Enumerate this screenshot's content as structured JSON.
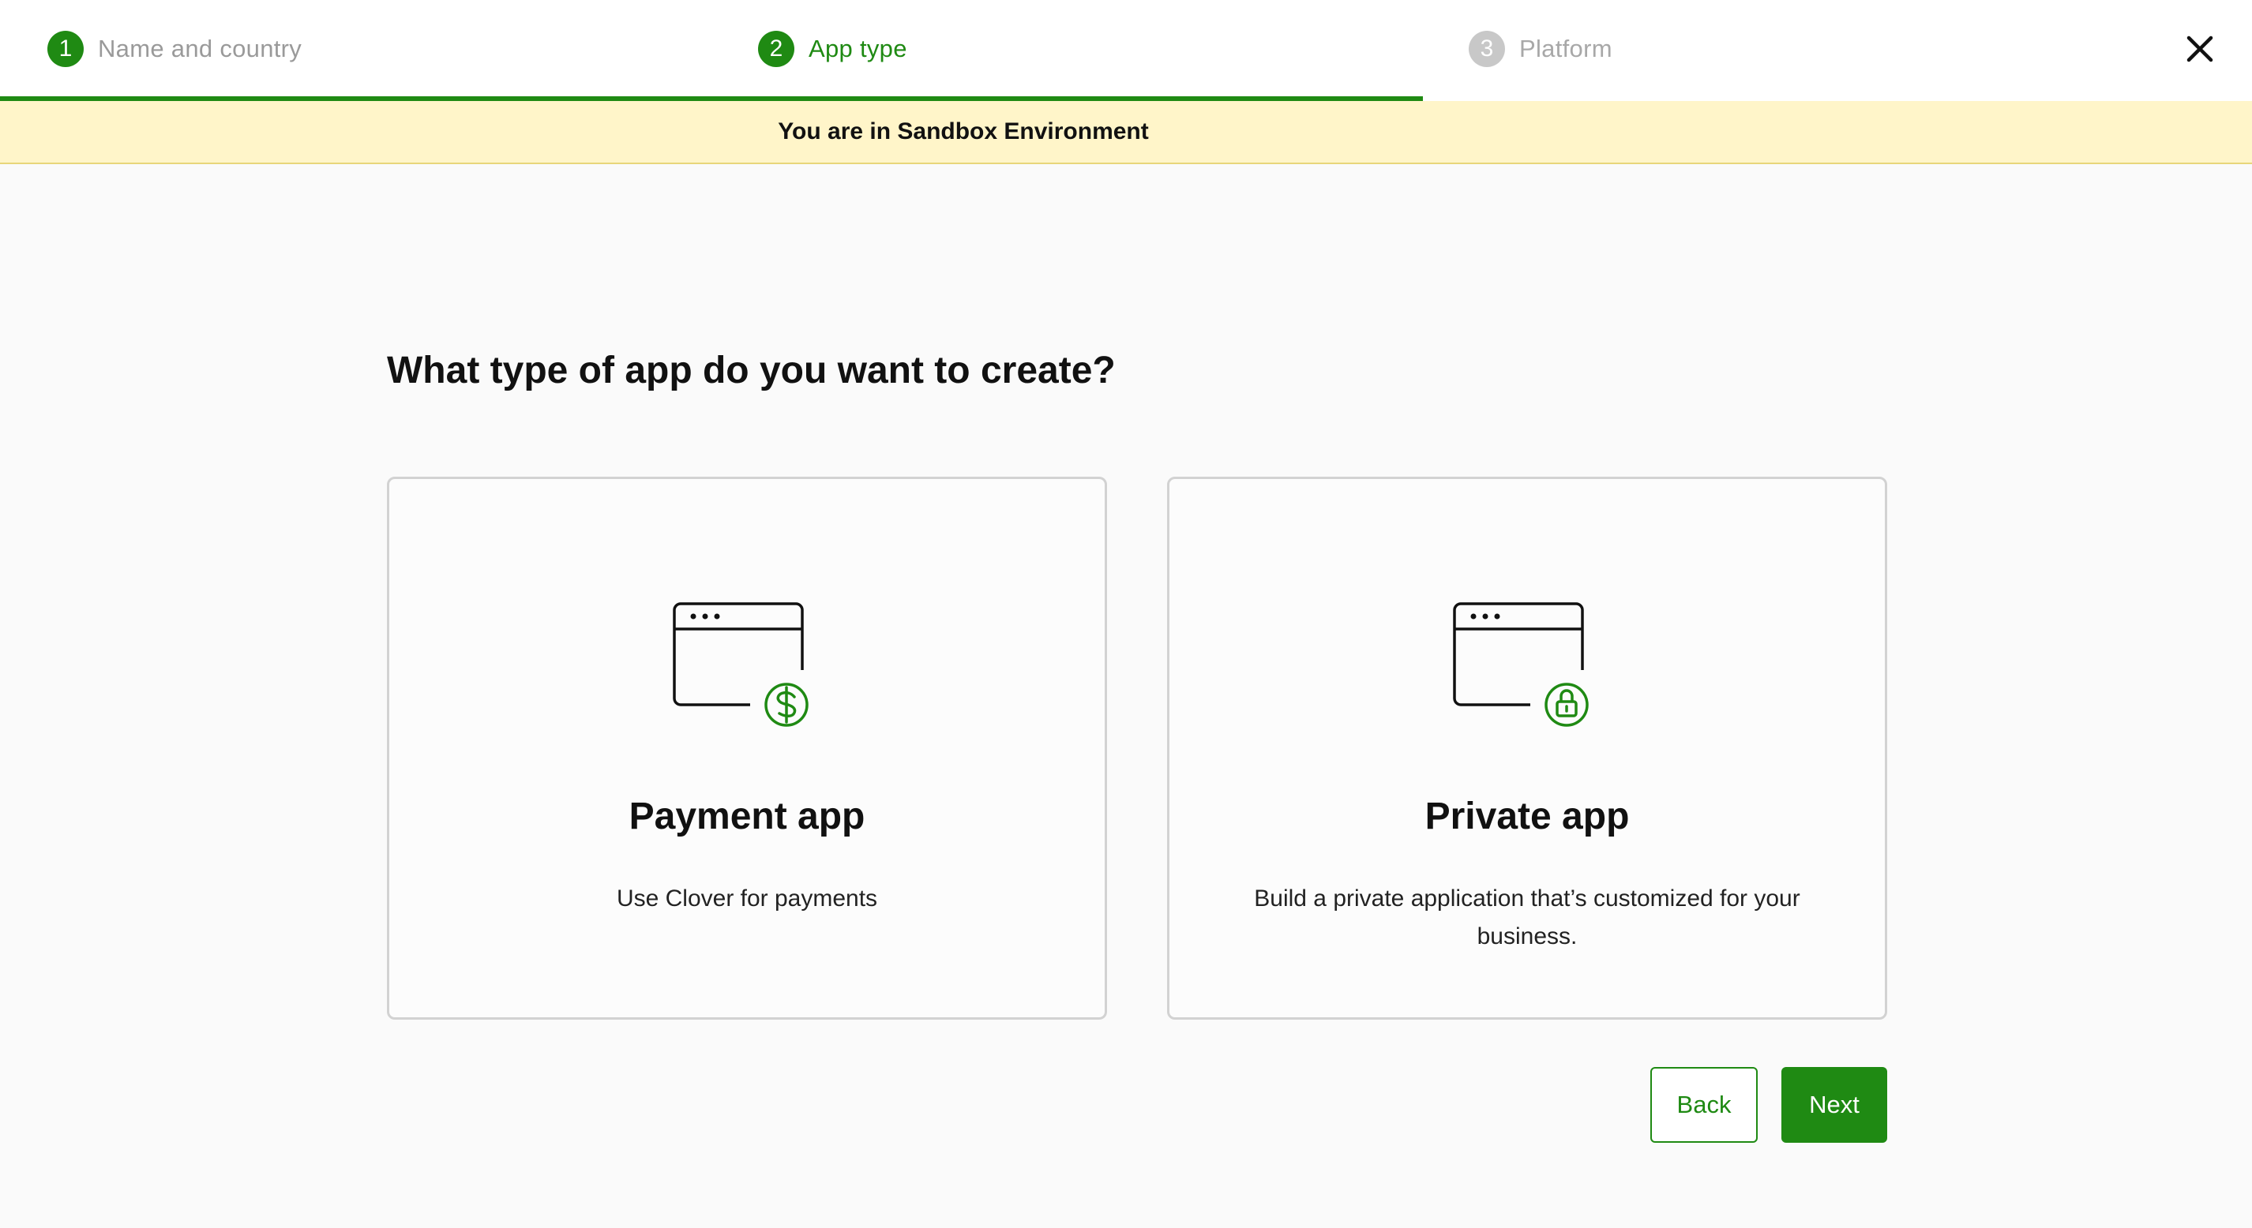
{
  "stepper": {
    "steps": [
      {
        "number": "1",
        "label": "Name and country",
        "state": "done"
      },
      {
        "number": "2",
        "label": "App type",
        "state": "active"
      },
      {
        "number": "3",
        "label": "Platform",
        "state": "todo"
      }
    ],
    "progress_fraction": 0.632
  },
  "banner": {
    "text": "You are in Sandbox Environment"
  },
  "main": {
    "heading": "What type of app do you want to create?",
    "cards": [
      {
        "title": "Payment app",
        "description": "Use Clover for payments",
        "icon": "browser-window-dollar-icon"
      },
      {
        "title": "Private app",
        "description": "Build a private application that’s customized for your business.",
        "icon": "browser-window-lock-icon"
      }
    ]
  },
  "actions": {
    "back_label": "Back",
    "next_label": "Next"
  },
  "colors": {
    "accent": "#1f8a13",
    "banner_bg": "#fff5c9",
    "inactive": "#c8c8c8"
  }
}
